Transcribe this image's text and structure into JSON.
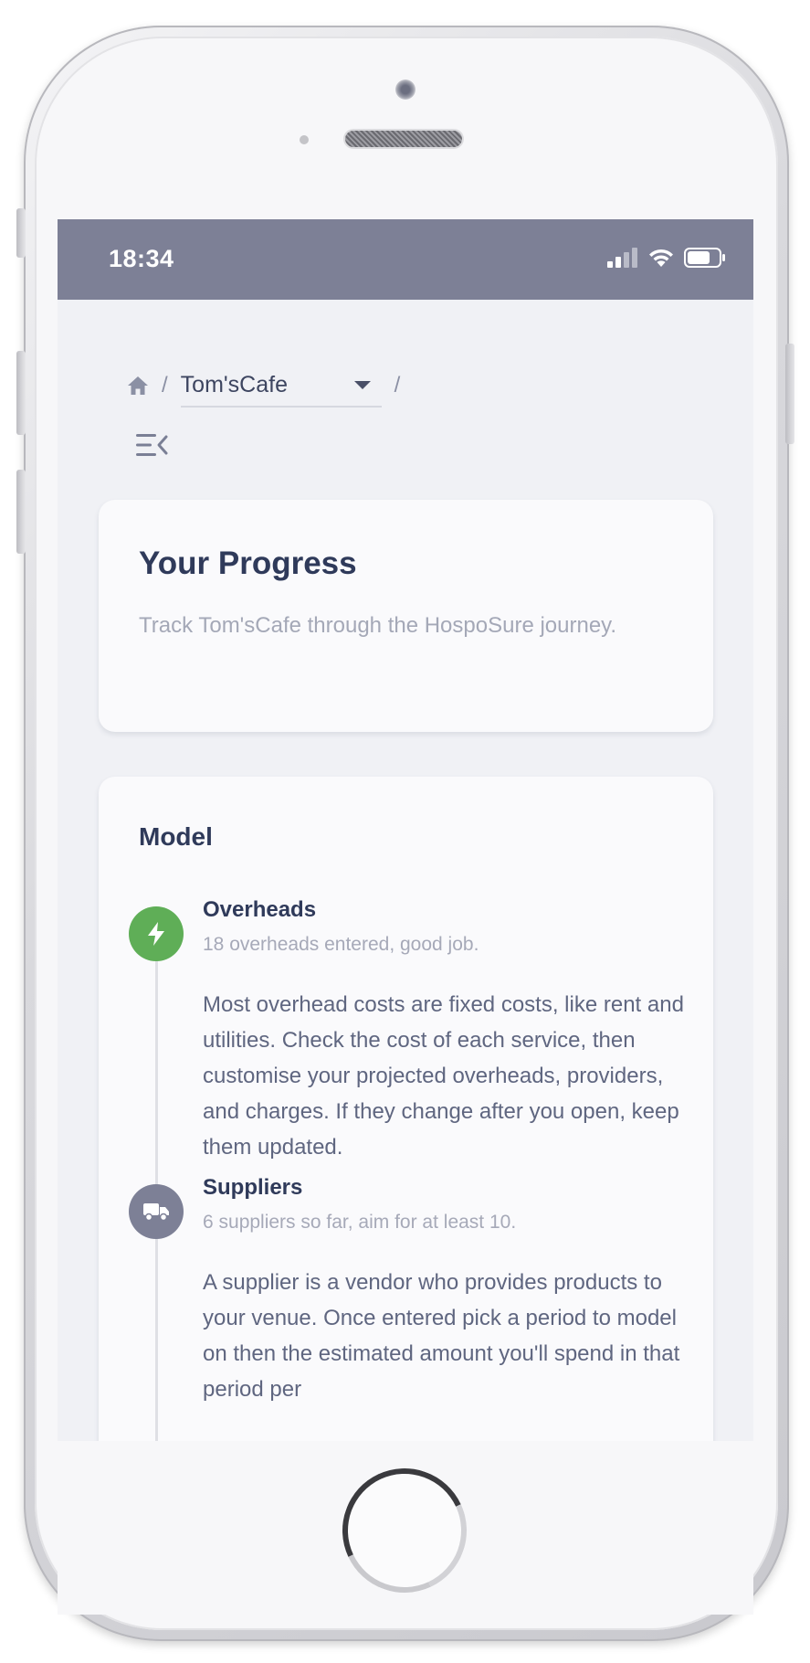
{
  "status_bar": {
    "time": "18:34",
    "icons": [
      "signal-icon",
      "wifi-icon",
      "battery-icon"
    ]
  },
  "breadcrumb": {
    "home_icon": "home-icon",
    "separator": "/",
    "venue": "Tom'sCafe",
    "dropdown_icon": "chevron-down-icon"
  },
  "menu_icon": "menu-collapse-icon",
  "progress_card": {
    "title": "Your Progress",
    "subtitle": "Track Tom'sCafe through the HospoSure journey."
  },
  "model_card": {
    "title": "Model",
    "steps": [
      {
        "title": "Overheads",
        "meta": "18 overheads entered, good job.",
        "description": "Most overhead costs are fixed costs, like rent and utilities. Check the cost of each service, then customise your projected overheads, providers, and charges. If they change after you open, keep them updated.",
        "icon": "lightning-icon",
        "status_color": "#5fae57"
      },
      {
        "title": "Suppliers",
        "meta": "6 suppliers so far, aim for at least 10.",
        "description": "A supplier is a vendor who provides products to your venue. Once entered pick a period to model on then the estimated amount you'll spend in that period per",
        "icon": "truck-icon",
        "status_color": "#7d8096"
      }
    ]
  },
  "colors": {
    "status_bar": "#7d8096",
    "heading": "#2f3a5a",
    "muted_text": "#a4a8b7",
    "body_text": "#5f6680",
    "complete": "#5fae57",
    "background": "#f0f1f5"
  }
}
